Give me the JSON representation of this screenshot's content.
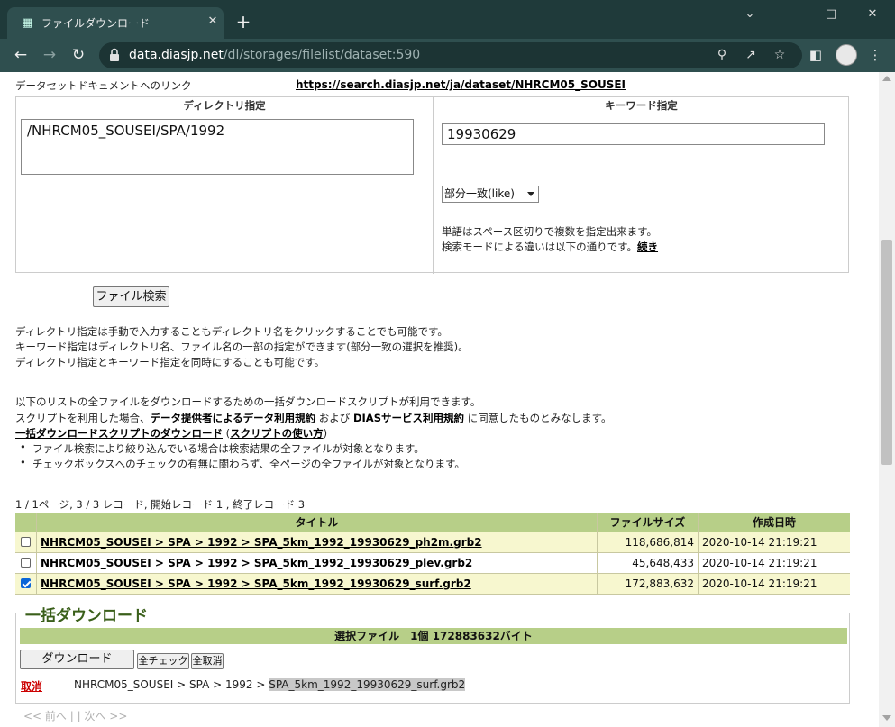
{
  "browser": {
    "tab_title": "ファイルダウンロード",
    "url_host": "data.diasjp.net",
    "url_path": "/dl/storages/filelist/dataset:590"
  },
  "page": {
    "doc_link_label": "データセットドキュメントへのリンク",
    "doc_link_url": "https://search.diasjp.net/ja/dataset/NHRCM05_SOUSEI",
    "search": {
      "dir_header": "ディレクトリ指定",
      "kw_header": "キーワード指定",
      "dir_value": "/NHRCM05_SOUSEI/SPA/1992",
      "kw_value": "19930629",
      "mode_selected": "部分一致(like)",
      "help_line1": "単語はスペース区切りで複数を指定出来ます。",
      "help_line2": "検索モードによる違いは以下の通りです。",
      "help_more": "続き",
      "search_button": "ファイル検索"
    },
    "notes": [
      "ディレクトリ指定は手動で入力することもディレクトリ名をクリックすることでも可能です。",
      "キーワード指定はディレクトリ名、ファイル名の一部の指定ができます(部分一致の選択を推奨)。",
      "ディレクトリ指定とキーワード指定を同時にすることも可能です。"
    ],
    "script_info": {
      "line1": "以下のリストの全ファイルをダウンロードするための一括ダウンロードスクリプトが利用できます。",
      "line2_pre": "スクリプトを利用した場合、",
      "line2_link1": "データ提供者によるデータ利用規約",
      "line2_mid": " および ",
      "line2_link2": "DIASサービス利用規約",
      "line2_post": " に同意したものとみなします。",
      "dl_link": "一括ダウンロードスクリプトのダウンロード",
      "usage_pre": " (",
      "usage_link": "スクリプトの使い方",
      "usage_post": ")",
      "bullet1": "ファイル検索により絞り込んでいる場合は検索結果の全ファイルが対象となります。",
      "bullet2": "チェックボックスへのチェックの有無に関わらず、全ページの全ファイルが対象となります。"
    },
    "pagination_summary": "1 / 1ページ, 3 / 3 レコード, 開始レコード 1 , 終了レコード 3",
    "table": {
      "headers": [
        "タイトル",
        "ファイルサイズ",
        "作成日時"
      ],
      "rows": [
        {
          "title": "NHRCM05_SOUSEI > SPA > 1992 > SPA_5km_1992_19930629_ph2m.grb2",
          "size": "118,686,814",
          "date": "2020-10-14 21:19:21",
          "checked": false
        },
        {
          "title": "NHRCM05_SOUSEI > SPA > 1992 > SPA_5km_1992_19930629_plev.grb2",
          "size": "45,648,433",
          "date": "2020-10-14 21:19:21",
          "checked": false
        },
        {
          "title": "NHRCM05_SOUSEI > SPA > 1992 > SPA_5km_1992_19930629_surf.grb2",
          "size": "172,883,632",
          "date": "2020-10-14 21:19:21",
          "checked": true
        }
      ]
    },
    "bulk": {
      "legend": "一括ダウンロード",
      "summary": "選択ファイル　1個 172883632バイト",
      "download_button": "ダウンロード",
      "check_all_button": "全チェック",
      "clear_all_button": "全取消",
      "cancel_link": "取消",
      "path_prefix": "NHRCM05_SOUSEI > SPA > 1992 > ",
      "path_file": "SPA_5km_1992_19930629_surf.grb2"
    },
    "pager_bottom": "<< 前へ | | 次へ >>"
  },
  "colors": {
    "chrome_dark": "#1f3a3a",
    "chrome_mid": "#2f4f4f",
    "table_header": "#b7cf88",
    "row_alt": "#f7f7cf",
    "legend_green": "#3a5f1a",
    "cancel_red": "#cc0000"
  }
}
